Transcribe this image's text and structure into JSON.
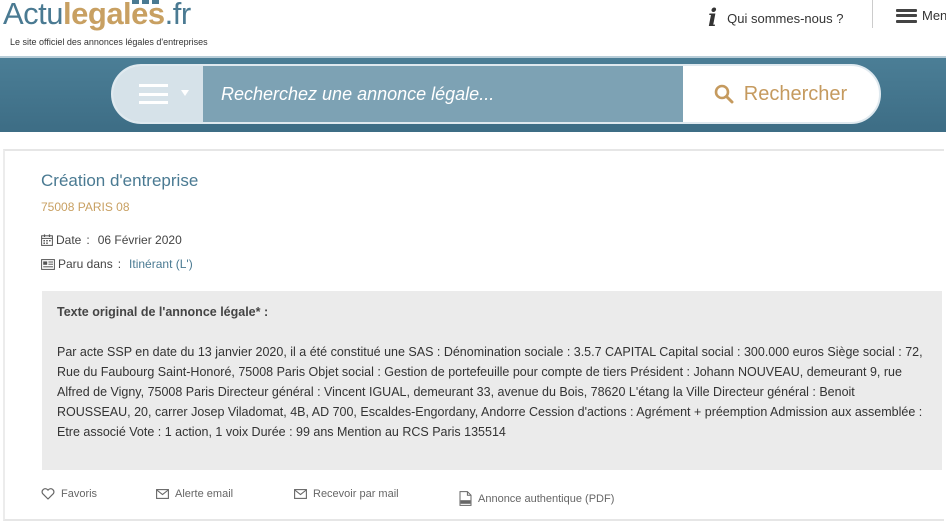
{
  "header": {
    "logo_part1": "Actu",
    "logo_part2": "legales",
    "logo_part3": ".fr",
    "tagline": "Le site officiel des annonces légales d'entreprises",
    "about_label": "Qui sommes-nous ?",
    "menu_label": "Menu"
  },
  "search": {
    "placeholder": "Recherchez une annonce légale...",
    "button_label": "Rechercher"
  },
  "annonce": {
    "title": "Création d'entreprise",
    "location": "75008 PARIS 08",
    "date_label": "Date",
    "date_value": "06 Février 2020",
    "paru_label": "Paru dans",
    "paru_value": "Itinérant (L')",
    "text_heading": "Texte original de l'annonce légale* :",
    "text_body": "Par acte SSP en date du 13 janvier 2020, il a été constitué une SAS : Dénomination sociale : 3.5.7 CAPITAL Capital social : 300.000 euros Siège social : 72, Rue du Faubourg Saint-Honoré, 75008 Paris Objet social : Gestion de portefeuille pour compte de tiers Président : Johann NOUVEAU, demeurant 9, rue Alfred de Vigny, 75008 Paris Directeur général : Vincent IGUAL, demeurant 33, avenue du Bois, 78620 L'étang la Ville Directeur général : Benoit ROUSSEAU, 20, carrer Josep Viladomat, 4B, AD 700, Escaldes-Engordany, Andorre Cession d'actions : Agrément + préemption Admission aux assemblée : Etre associé Vote : 1 action, 1 voix Durée : 99 ans Mention au RCS Paris 135514"
  },
  "actions": {
    "favoris": "Favoris",
    "alerte": "Alerte email",
    "recevoir": "Recevoir par mail",
    "pdf": "Annonce authentique (PDF)"
  },
  "icons": {
    "about": "info-icon",
    "menu": "hamburger-icon",
    "search": "magnifier-icon",
    "date": "calendar-icon",
    "paru": "newspaper-icon",
    "favoris": "heart-icon",
    "alerte": "envelope-icon",
    "recevoir": "envelope-icon",
    "pdf": "pdf-file-icon"
  },
  "colors": {
    "brand_blue": "#4a7a92",
    "brand_gold": "#c8a062",
    "band": "#447690",
    "search_field": "#7da2b4"
  }
}
